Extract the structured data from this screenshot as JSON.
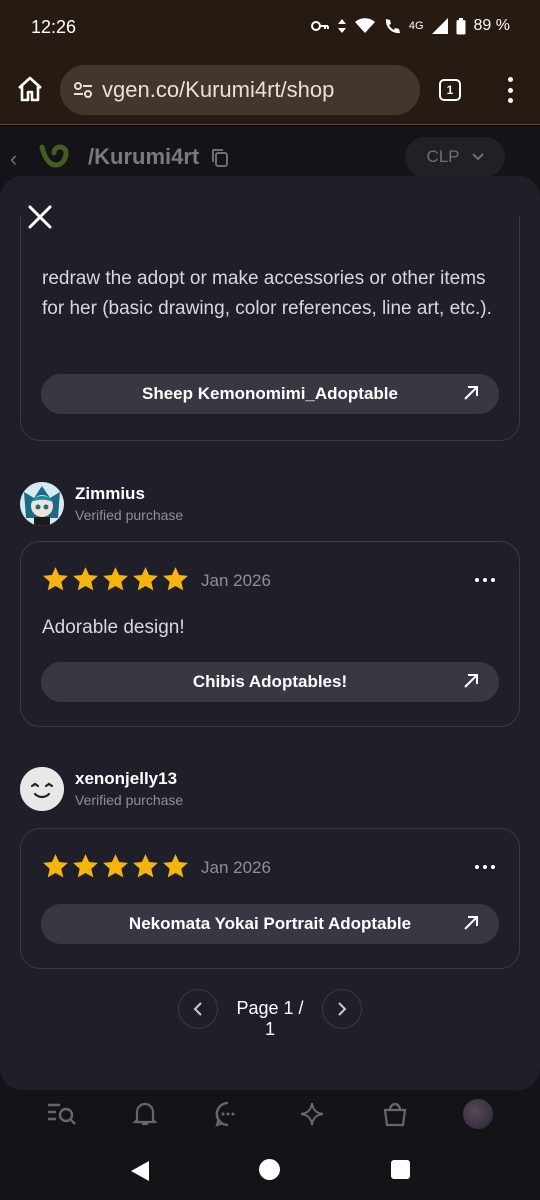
{
  "status_bar": {
    "time": "12:26",
    "network": "4G",
    "battery": "89 %"
  },
  "browser": {
    "url": "vgen.co/Kurumi4rt/shop",
    "tab_count": "1"
  },
  "profile_header": {
    "handle": "/Kurumi4rt",
    "currency": "CLP"
  },
  "modal": {
    "first_review_partial_text": "redraw the adopt or make accessories or other items for her (basic drawing, color references, line art, etc.).",
    "first_review_product": "Sheep Kemonomimi_Adoptable",
    "reviews": [
      {
        "reviewer": "Zimmius",
        "badge": "Verified purchase",
        "rating": 5,
        "date": "Jan 2026",
        "text": "Adorable design!",
        "product": "Chibis Adoptables!"
      },
      {
        "reviewer": "xenonjelly13",
        "badge": "Verified purchase",
        "rating": 5,
        "date": "Jan 2026",
        "text": "",
        "product": "Nekomata Yokai Portrait Adoptable"
      }
    ],
    "pagination": {
      "label": "Page 1 / 1"
    }
  },
  "colors": {
    "modal_bg": "#1f1f2a",
    "star": "#f6b40e",
    "card_border": "#3a3a47",
    "button_bg": "#383843"
  }
}
